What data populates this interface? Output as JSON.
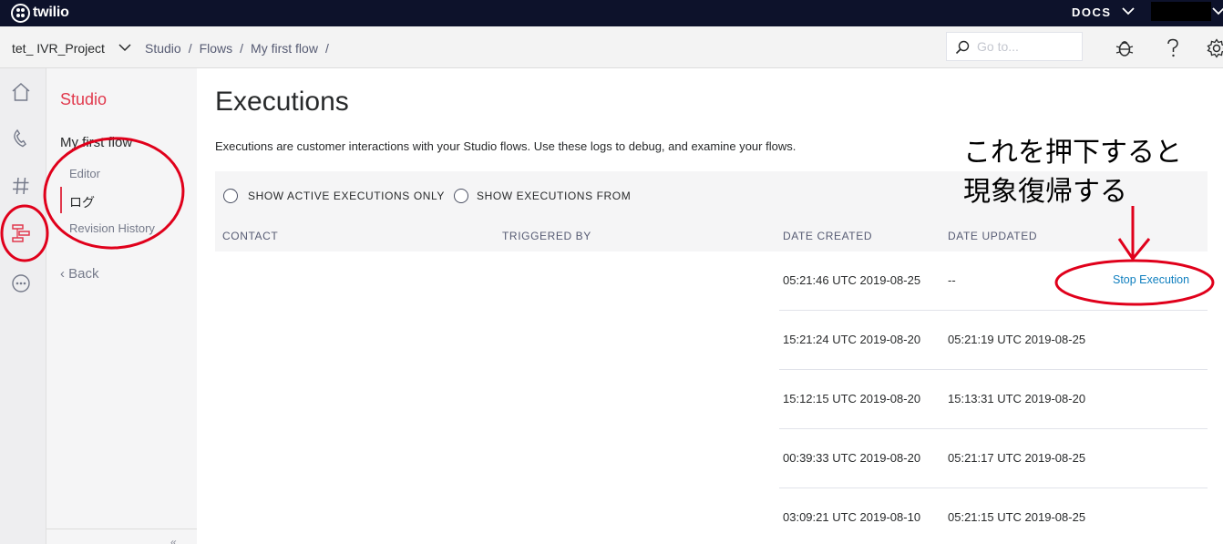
{
  "topbar": {
    "logo_text": "twilio",
    "docs_label": "DOCS"
  },
  "subheader": {
    "project_name": "tet_ IVR_Project",
    "breadcrumbs": [
      "Studio",
      "Flows",
      "My first flow"
    ],
    "breadcrumb_trailing_sep": "/",
    "search_placeholder": "Go to..."
  },
  "nav": {
    "title": "Studio",
    "flow_name": "My first flow",
    "items": [
      {
        "label": "Editor",
        "active": false
      },
      {
        "label": "ログ",
        "active": true
      },
      {
        "label": "Revision History",
        "active": false
      }
    ],
    "back_label": "Back",
    "collapse_label": "«"
  },
  "main": {
    "title": "Executions",
    "description": "Executions are customer interactions with your Studio flows. Use these logs to debug, and examine your flows.",
    "filters": [
      {
        "label": "SHOW ACTIVE EXECUTIONS ONLY",
        "checked": false
      },
      {
        "label": "SHOW EXECUTIONS FROM",
        "checked": false
      }
    ],
    "columns": [
      "CONTACT",
      "TRIGGERED BY",
      "DATE CREATED",
      "DATE UPDATED"
    ],
    "rows": [
      {
        "contact": "",
        "triggered_by": "",
        "date_created": "05:21:46 UTC 2019-08-25",
        "date_updated": "--",
        "action": "Stop Execution"
      },
      {
        "contact": "",
        "triggered_by": "",
        "date_created": "15:21:24 UTC 2019-08-20",
        "date_updated": "05:21:19 UTC 2019-08-25",
        "action": ""
      },
      {
        "contact": "",
        "triggered_by": "",
        "date_created": "15:12:15 UTC 2019-08-20",
        "date_updated": "15:13:31 UTC 2019-08-20",
        "action": ""
      },
      {
        "contact": "",
        "triggered_by": "",
        "date_created": "00:39:33 UTC 2019-08-20",
        "date_updated": "05:21:17 UTC 2019-08-25",
        "action": ""
      },
      {
        "contact": "",
        "triggered_by": "",
        "date_created": "03:09:21 UTC 2019-08-10",
        "date_updated": "05:21:15 UTC 2019-08-25",
        "action": ""
      }
    ]
  },
  "annotation": {
    "line1": "これを押下すると",
    "line2": "現象復帰する"
  },
  "colors": {
    "topbar": "#0d122b",
    "brand_red": "#e1394d",
    "link_blue": "#0f7fbf",
    "annotation_red": "#e0001b"
  },
  "icons": [
    "twilio-logo-icon",
    "chevron-down-icon",
    "search-icon",
    "bug-icon",
    "help-icon",
    "gear-icon",
    "home-icon",
    "phone-icon",
    "hash-icon",
    "studio-flow-icon",
    "more-icon"
  ]
}
